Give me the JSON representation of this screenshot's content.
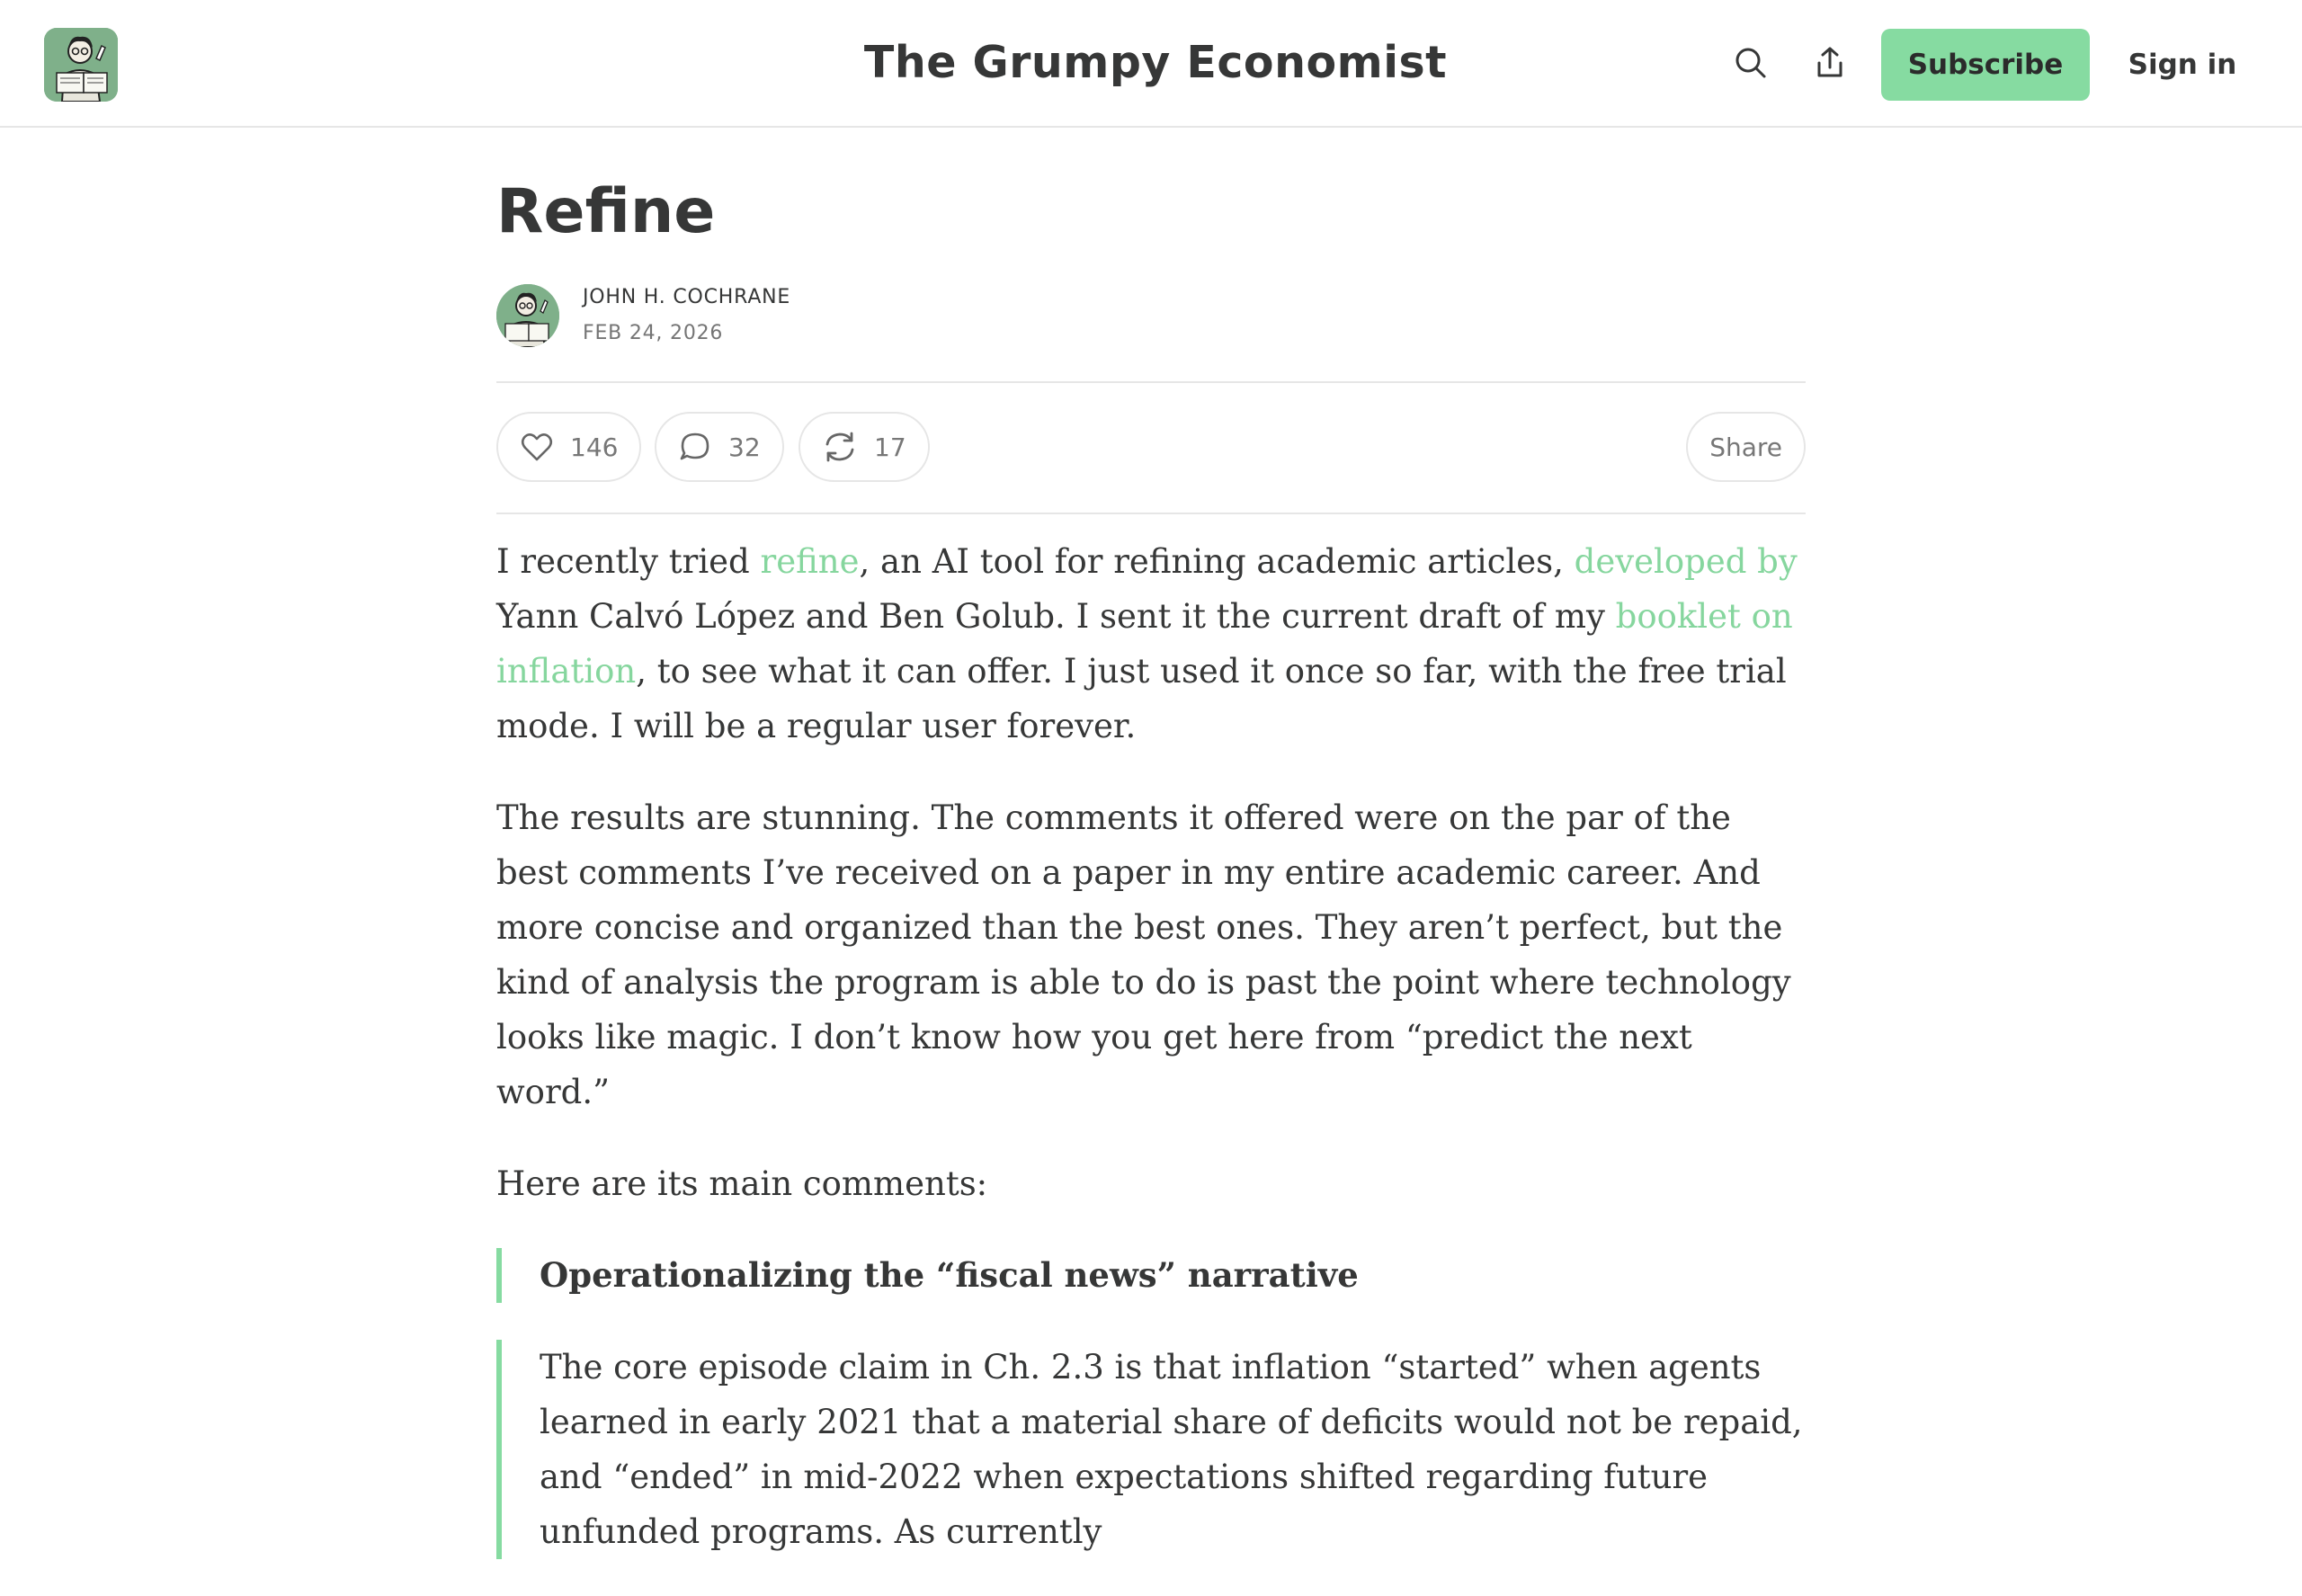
{
  "header": {
    "site_title": "The Grumpy Economist",
    "logo_icon": "cartoon-reader-logo",
    "search_icon": "search-icon",
    "share_icon": "share-upload-icon",
    "subscribe_label": "Subscribe",
    "signin_label": "Sign in",
    "accent_color": "#86dba1"
  },
  "post": {
    "title": "Refine",
    "author": "JOHN H. COCHRANE",
    "date": "FEB 24, 2026",
    "actions": {
      "likes": "146",
      "comments": "32",
      "restacks": "17",
      "share_label": "Share"
    },
    "paragraphs": {
      "p1": {
        "t1": "I recently tried ",
        "link1": "refine",
        "t2": ", an AI tool for refining academic articles, ",
        "link2": "developed by",
        "t3": " Yann Calvó López and Ben Golub. I sent it the current draft of my ",
        "link3": "booklet on inflation",
        "t4": ", to see what it can offer. I just used it once so far, with the free trial mode. I will be a regular user forever."
      },
      "p2": "The results are stunning. The comments it offered were on the par of the best comments I’ve received on a paper in my entire academic career. And more concise and organized than the best ones. They aren’t perfect, but the kind of analysis the program is able to do is past the point where technology looks like magic. I don’t know how you get here from “predict the next word.”",
      "p3": "Here are its main comments:"
    },
    "quotes": {
      "heading": "Operationalizing the “fiscal news” narrative",
      "body": "The core episode claim in Ch. 2.3 is that inflation “started” when agents learned in early 2021 that a material share of deficits would not be repaid, and “ended” in mid-2022 when expectations shifted regarding future unfunded programs. As currently"
    }
  }
}
